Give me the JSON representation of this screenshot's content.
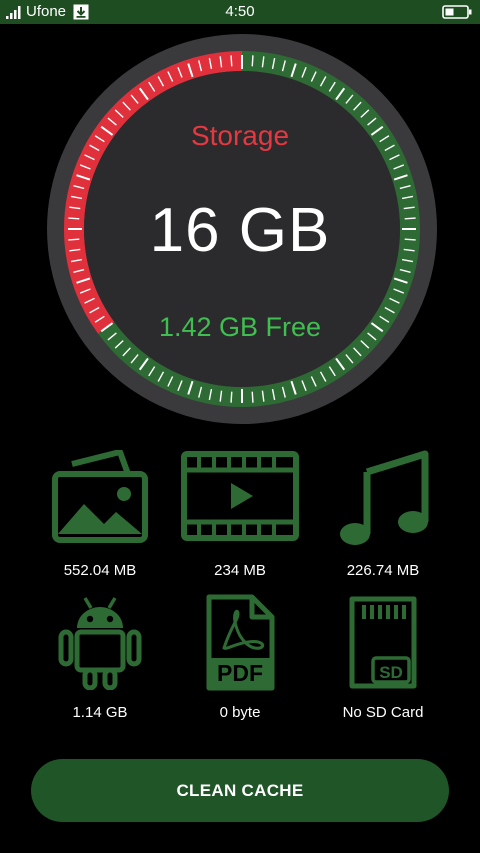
{
  "status_bar": {
    "carrier": "Ufone",
    "time": "4:50"
  },
  "gauge": {
    "title": "Storage",
    "total": "16 GB",
    "free": "1.42 GB Free",
    "used_fraction": 0.35
  },
  "categories": [
    {
      "label": "552.04 MB",
      "icon": "image-icon"
    },
    {
      "label": "234 MB",
      "icon": "video-icon"
    },
    {
      "label": "226.74 MB",
      "icon": "music-icon"
    },
    {
      "label": "1.14 GB",
      "icon": "android-icon"
    },
    {
      "label": "0 byte",
      "icon": "pdf-icon"
    },
    {
      "label": "No SD Card",
      "icon": "sd-card-icon"
    }
  ],
  "colors": {
    "accent_green": "#2e6b34",
    "used_red": "#e0303c",
    "free_text": "#3fbf4f",
    "title_red": "#e53841"
  },
  "clean_button": {
    "label": "CLEAN CACHE"
  }
}
